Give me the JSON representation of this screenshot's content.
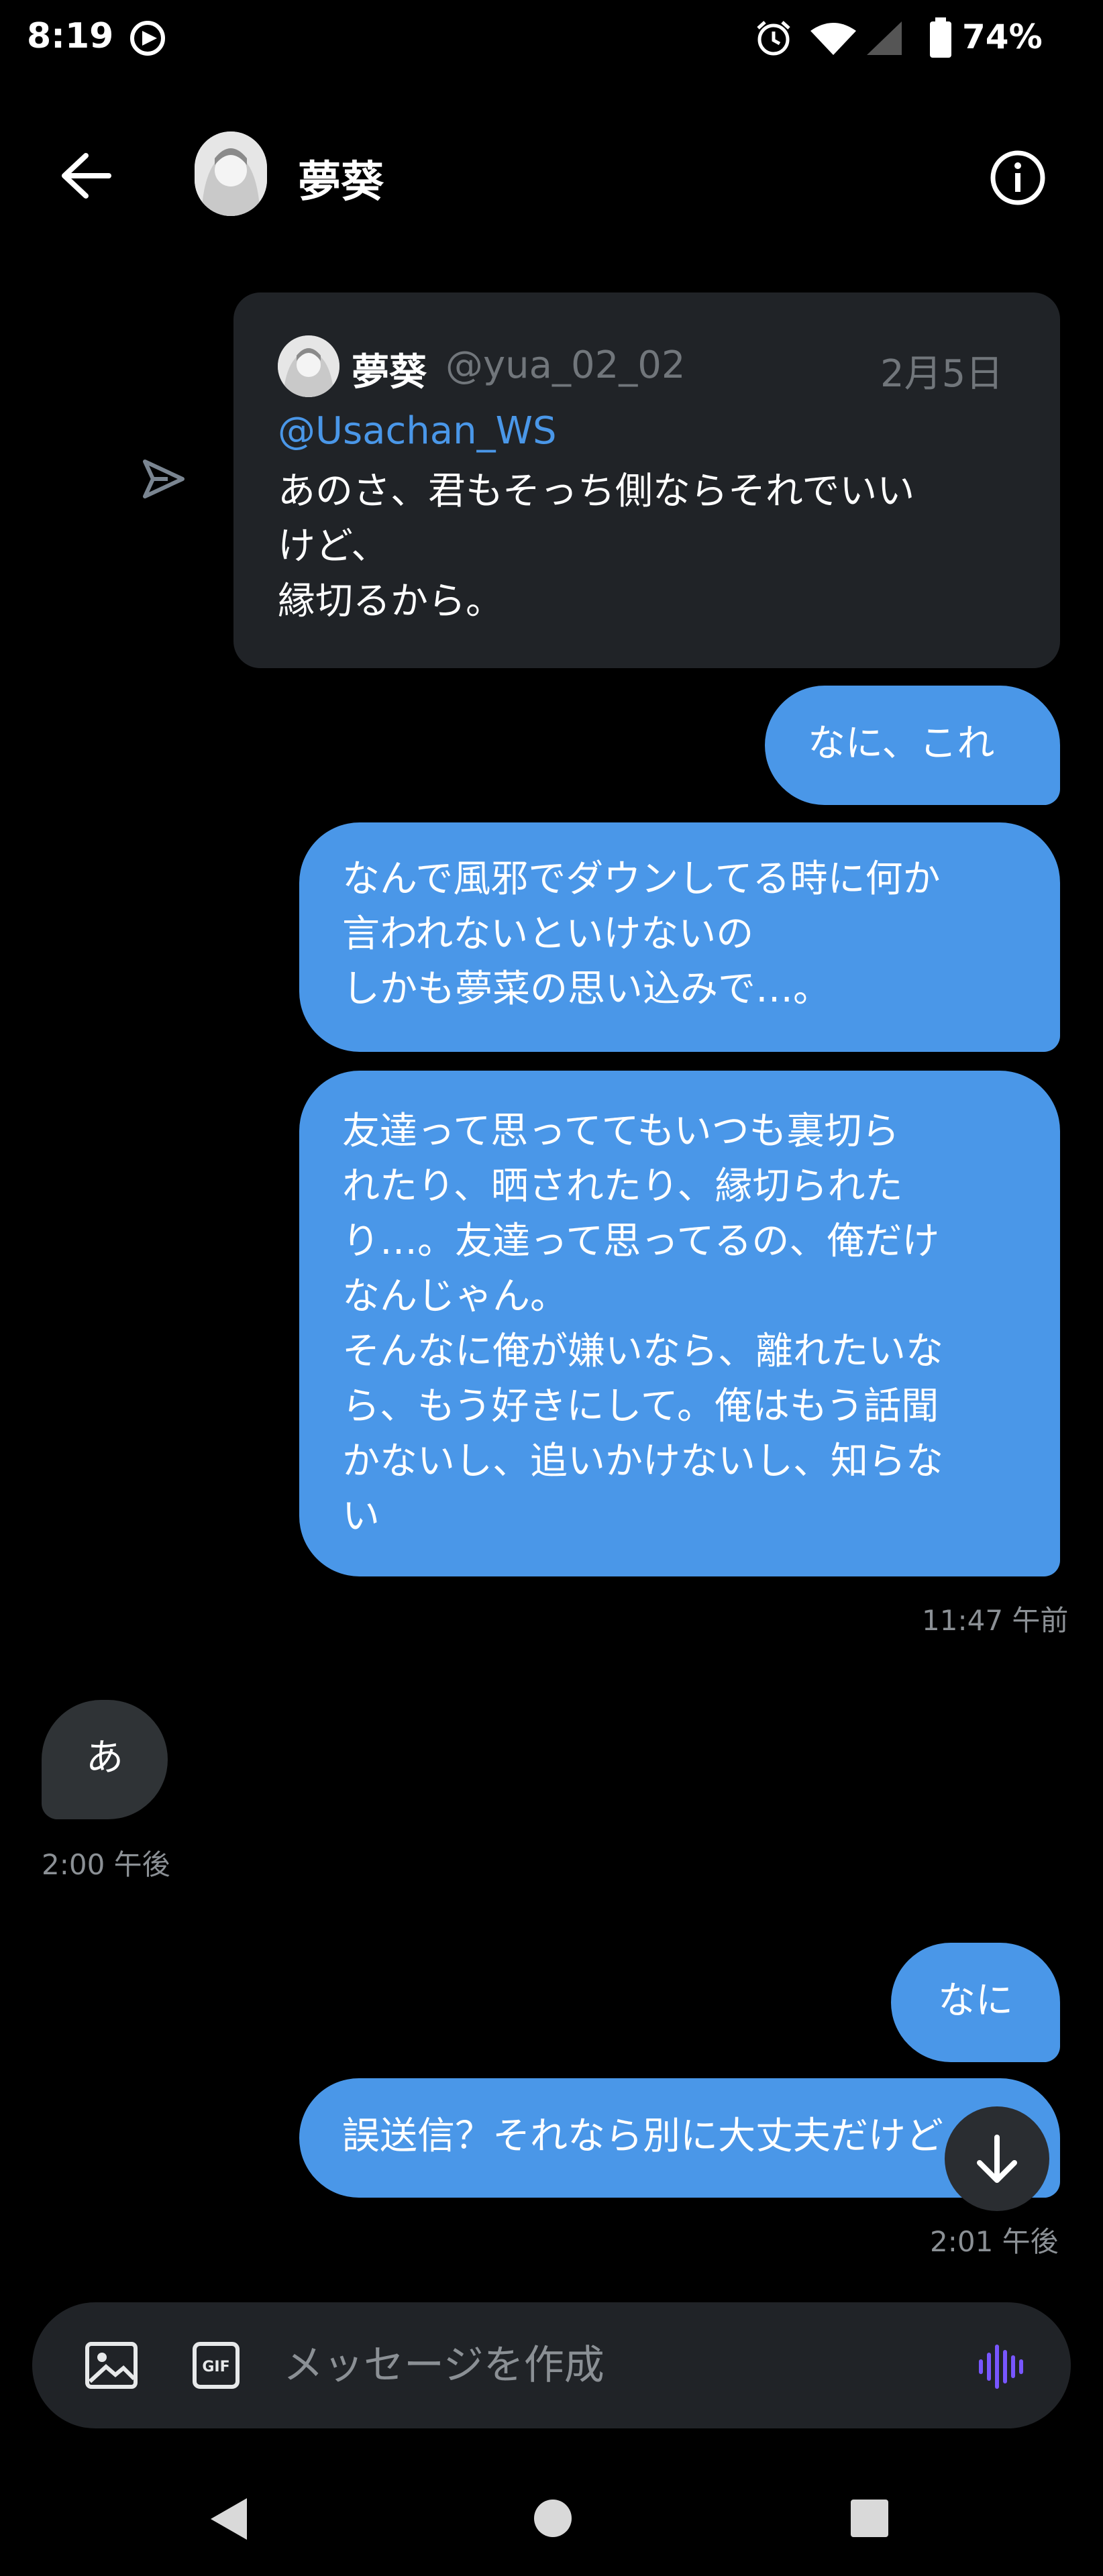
{
  "status_bar": {
    "time": "8:19",
    "battery": "74%"
  },
  "header": {
    "title": "夢葵"
  },
  "quoted_tweet": {
    "name": "夢葵",
    "handle": "@yua_02_02",
    "date": "2月5日",
    "mention": "@Usachan_WS",
    "body": "あのさ、君もそっち側ならそれでいい\nけど、\n縁切るから。"
  },
  "messages": [
    {
      "text": "なに、これ"
    },
    {
      "text": "なんで風邪でダウンしてる時に何か\n言われないといけないの\nしかも夢菜の思い込みで…。"
    },
    {
      "text": "友達って思っててもいつも裏切ら\nれたり、晒されたり、縁切られた\nり…。友達って思ってるの、俺だけ\nなんじゃん。\nそんなに俺が嫌いなら、離れたいな\nら、もう好きにして。俺はもう話聞\nかないし、追いかけないし、知らな\nい"
    },
    {
      "time": "11:47 午前"
    },
    {
      "text": "あ",
      "time": "2:00 午後"
    },
    {
      "text": "なに"
    },
    {
      "text": "誤送信？それなら別に大丈夫だけど",
      "time": "2:01 午後"
    }
  ],
  "composer": {
    "placeholder": "メッセージを作成"
  },
  "icons": {
    "back": "back-arrow-icon",
    "info": "info-icon",
    "share": "share-icon",
    "image": "image-icon",
    "gif": "gif-icon",
    "voice": "voice-icon",
    "scroll_down": "arrow-down-icon"
  },
  "colors": {
    "accent": "#4a97e8",
    "incoming": "#2f3336",
    "card": "#202327",
    "voice": "#7856ff"
  }
}
